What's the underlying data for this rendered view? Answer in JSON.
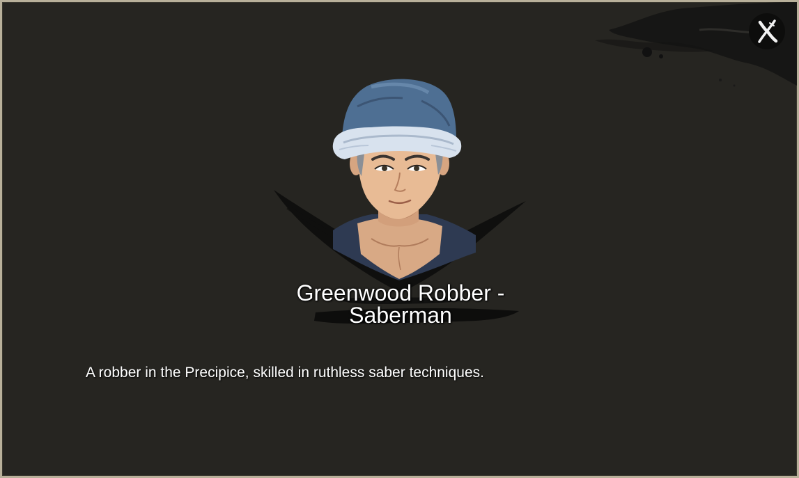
{
  "dialog": {
    "close_icon": "close-x-icon",
    "character": {
      "name": "Greenwood Robber - Saberman",
      "description": "A robber in the Precipice, skilled in ruthless saber techniques.",
      "portrait_icon": "character-portrait-saberman"
    }
  },
  "colors": {
    "background": "#262521",
    "border": "#b8b09a",
    "hat": "#4e6f93",
    "fur": "#d8e2ee",
    "text": "#ffffff"
  }
}
